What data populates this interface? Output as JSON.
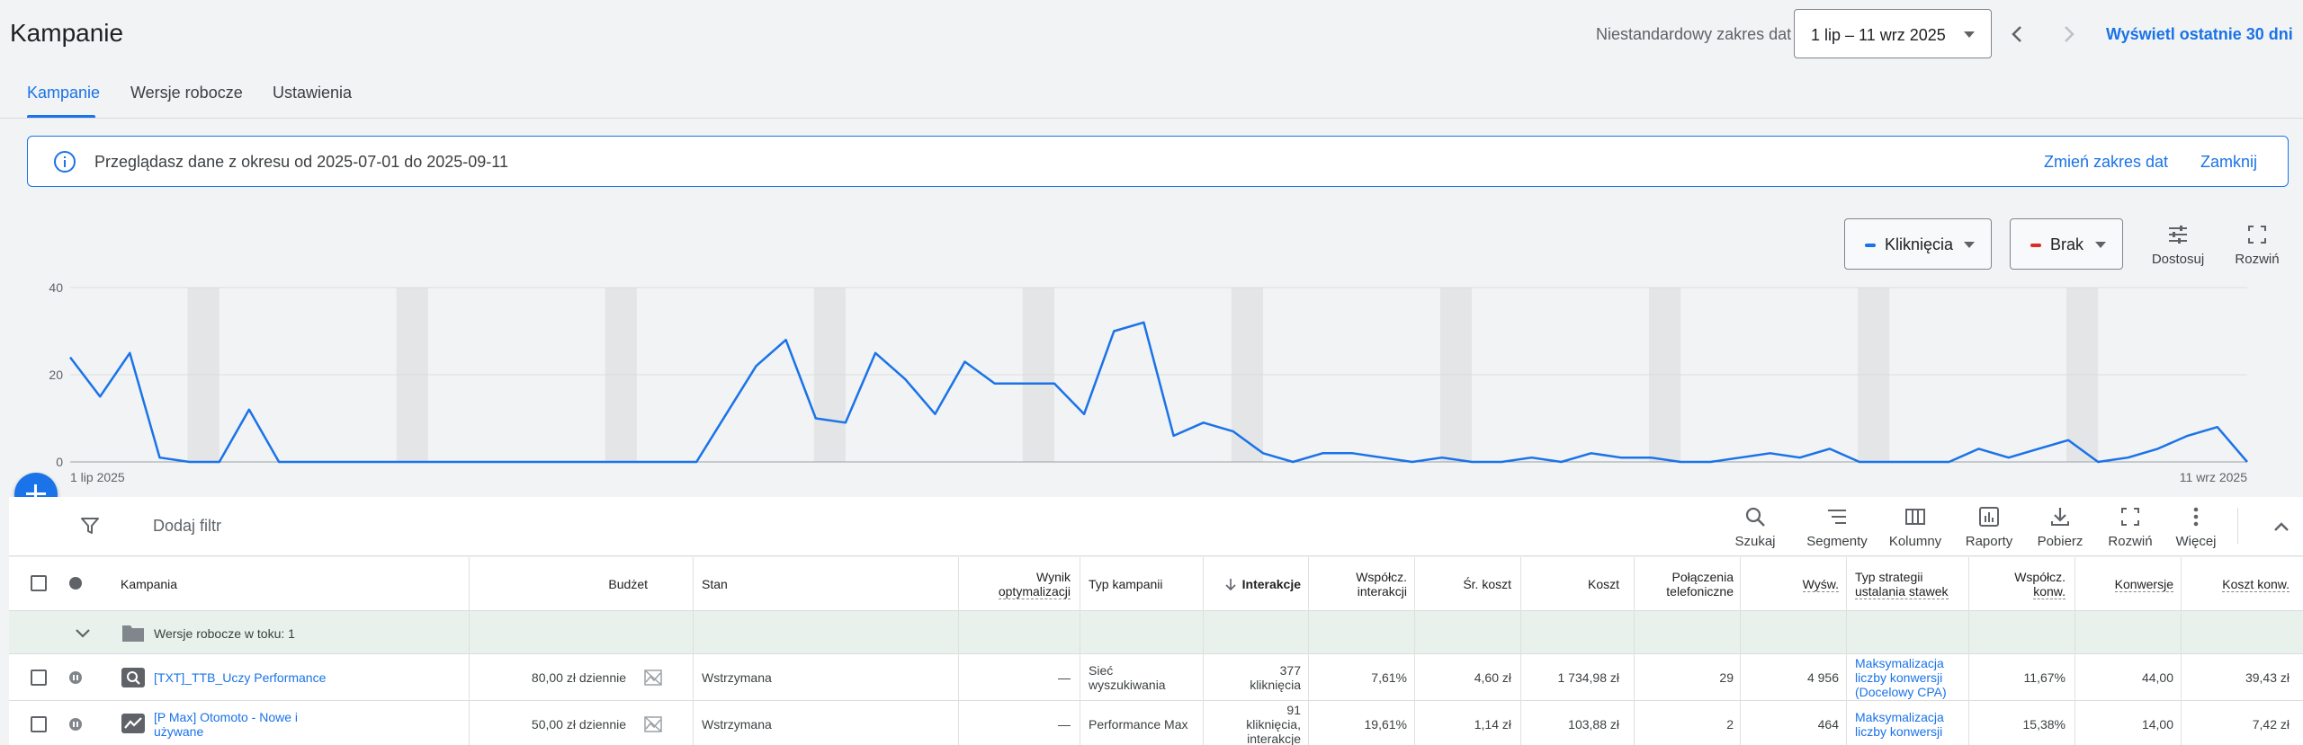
{
  "header": {
    "title": "Kampanie",
    "range_label": "Niestandardowy zakres dat",
    "date_range": "1 lip – 11 wrz 2025",
    "last_30_label": "Wyświetl ostatnie 30 dni"
  },
  "tabs": [
    {
      "label": "Kampanie",
      "active": true
    },
    {
      "label": "Wersje robocze",
      "active": false
    },
    {
      "label": "Ustawienia",
      "active": false
    }
  ],
  "banner": {
    "text": "Przeglądasz dane z okresu od 2025-07-01 do 2025-09-11",
    "change_link": "Zmień zakres dat",
    "close_link": "Zamknij"
  },
  "chart_controls": {
    "metric1": "Kliknięcia",
    "metric1_color": "#1a73e8",
    "metric2": "Brak",
    "metric2_color": "#d93025",
    "customize_label": "Dostosuj",
    "expand_label": "Rozwiń"
  },
  "chart_data": {
    "type": "line",
    "x_start_label": "1 lip 2025",
    "x_end_label": "11 wrz 2025",
    "y_ticks": [
      0,
      20,
      40
    ],
    "ylim": [
      0,
      40
    ],
    "grid": true,
    "series": [
      {
        "name": "Kliknięcia",
        "color": "#1a73e8",
        "values": [
          24,
          15,
          25,
          1,
          0,
          0,
          12,
          0,
          0,
          0,
          0,
          0,
          0,
          0,
          0,
          0,
          0,
          0,
          0,
          0,
          0,
          0,
          11,
          22,
          28,
          10,
          9,
          25,
          19,
          11,
          23,
          18,
          18,
          18,
          11,
          30,
          32,
          6,
          9,
          7,
          2,
          0,
          2,
          2,
          1,
          0,
          1,
          0,
          0,
          1,
          0,
          2,
          1,
          1,
          0,
          0,
          1,
          2,
          1,
          3,
          0,
          0,
          0,
          0,
          3,
          1,
          3,
          5,
          0,
          1,
          3,
          6,
          8,
          0
        ]
      }
    ],
    "weekend_bands": [
      4,
      11,
      18,
      25,
      32,
      39,
      46,
      53,
      60,
      67
    ]
  },
  "toolbar": {
    "add_filter": "Dodaj filtr",
    "items": [
      {
        "label": "Szukaj",
        "icon": "search-icon"
      },
      {
        "label": "Segmenty",
        "icon": "segments-icon"
      },
      {
        "label": "Kolumny",
        "icon": "columns-icon"
      },
      {
        "label": "Raporty",
        "icon": "reports-icon"
      },
      {
        "label": "Pobierz",
        "icon": "download-icon"
      },
      {
        "label": "Rozwiń",
        "icon": "expand-icon"
      },
      {
        "label": "Więcej",
        "icon": "more-icon"
      }
    ]
  },
  "table": {
    "headers": {
      "campaign": "Kampania",
      "budget": "Budżet",
      "status": "Stan",
      "opt_score_1": "Wynik",
      "opt_score_2": "optymalizacji",
      "campaign_type": "Typ kampanii",
      "interactions": "Interakcje",
      "interaction_rate_1": "Współcz.",
      "interaction_rate_2": "interakcji",
      "avg_cost": "Śr. koszt",
      "cost": "Koszt",
      "phone_calls_1": "Połączenia",
      "phone_calls_2": "telefoniczne",
      "impressions": "Wyśw.",
      "bid_strategy_1": "Typ strategii",
      "bid_strategy_2": "ustalania stawek",
      "conv_rate_1": "Współcz.",
      "conv_rate_2": "konw.",
      "conversions": "Konwersje",
      "cost_conv": "Koszt konw."
    },
    "group_label": "Wersje robocze w toku: 1",
    "rows": [
      {
        "name": "[TXT]_TTB_Uczy Performance",
        "budget": "80,00 zł dziennie",
        "status": "Wstrzymana",
        "opt_score": "—",
        "type_1": "Sieć",
        "type_2": "wyszukiwania",
        "interactions_1": "377",
        "interactions_2": "kliknięcia",
        "interaction_rate": "7,61%",
        "avg_cost": "4,60 zł",
        "cost": "1 734,98 zł",
        "phone_calls": "29",
        "impressions": "4 956",
        "bid_1": "Maksymalizacja",
        "bid_2": "liczby konwersji",
        "bid_3": "(Docelowy CPA)",
        "conv_rate": "11,67%",
        "conversions": "44,00",
        "cost_conv": "39,43 zł"
      },
      {
        "name_1": "[P Max] Otomoto - Nowe i",
        "name_2": "używane",
        "budget": "50,00 zł dziennie",
        "status": "Wstrzymana",
        "opt_score": "—",
        "type": "Performance Max",
        "interactions_1": "91",
        "interactions_2": "kliknięcia,",
        "interactions_3": "interakcje",
        "interaction_rate": "19,61%",
        "avg_cost": "1,14 zł",
        "cost": "103,88 zł",
        "phone_calls": "2",
        "impressions": "464",
        "bid_1": "Maksymalizacja",
        "bid_2": "liczby konwersji",
        "conv_rate": "15,38%",
        "conversions": "14,00",
        "cost_conv": "7,42 zł"
      }
    ]
  }
}
